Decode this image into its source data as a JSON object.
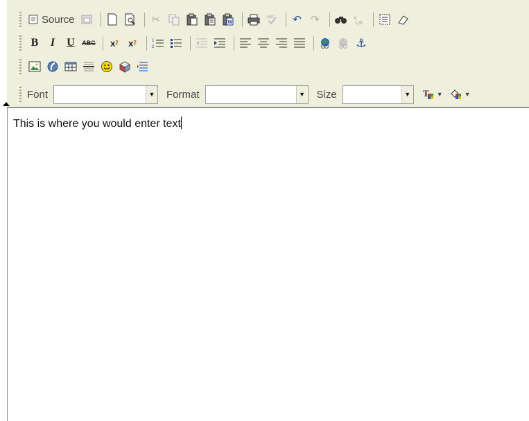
{
  "toolbar": {
    "source_label": "Source",
    "font_label": "Font",
    "format_label": "Format",
    "size_label": "Size",
    "font_value": "",
    "format_value": "",
    "size_value": ""
  },
  "editor": {
    "content": "This is where you would enter text"
  },
  "colors": {
    "toolbar_bg": "#efefde",
    "border": "#8f8f8f",
    "separator": "#a9a994"
  }
}
